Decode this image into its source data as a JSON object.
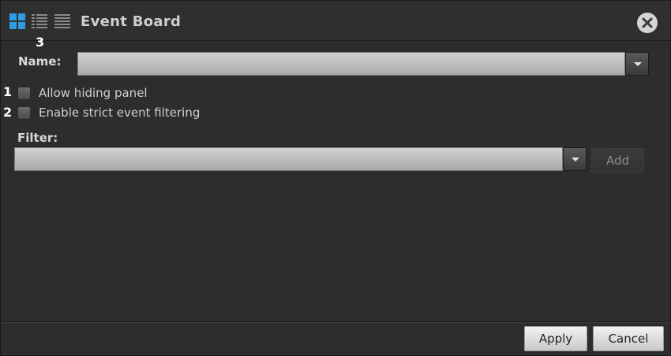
{
  "window": {
    "title": "Event Board",
    "view_icons": [
      "grid-view-icon",
      "list-detail-view-icon",
      "list-view-icon"
    ],
    "close_icon": "close-icon"
  },
  "annotations": {
    "n1": "1",
    "n2": "2",
    "n3": "3"
  },
  "form": {
    "name_label": "Name:",
    "name_value": "",
    "options": [
      {
        "label": "Allow hiding panel",
        "checked": false
      },
      {
        "label": "Enable strict event filtering",
        "checked": false
      }
    ],
    "filter_label": "Filter:",
    "filter_value": "",
    "add_label": "Add"
  },
  "footer": {
    "apply_label": "Apply",
    "cancel_label": "Cancel"
  },
  "colors": {
    "accent": "#2e9de6",
    "background": "#2d2d2d"
  }
}
